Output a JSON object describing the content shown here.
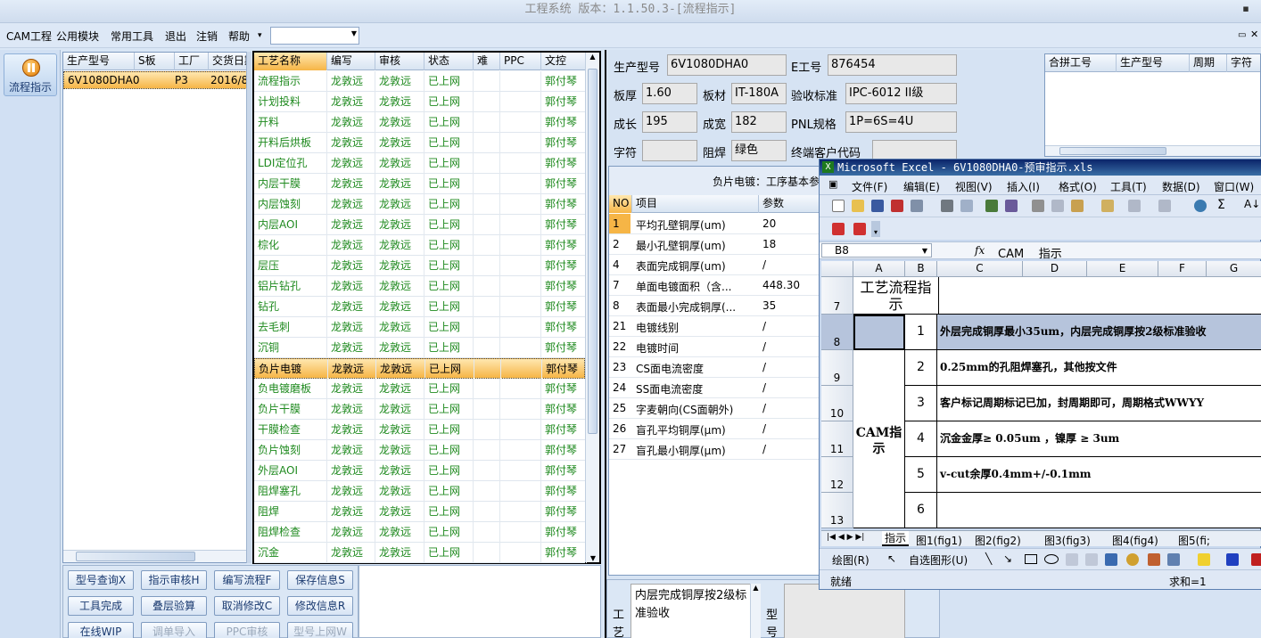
{
  "window": {
    "title": "工程系统 版本：1.1.50.3-[流程指示]"
  },
  "menu": {
    "items": [
      "CAM工程",
      "公用模块",
      "常用工具",
      "退出",
      "注销",
      "帮助"
    ],
    "combo_value": ""
  },
  "sidebar": {
    "flow_label": "流程指示"
  },
  "order_table": {
    "headers": [
      "生产型号",
      "S板",
      "工厂",
      "交货日期"
    ],
    "rows": [
      {
        "model": "6V1080DHA0",
        "s": "",
        "factory": "P3",
        "date": "2016/8"
      }
    ]
  },
  "process_table": {
    "headers": [
      "工艺名称",
      "编写",
      "审核",
      "状态",
      "难",
      "PPC",
      "文控"
    ],
    "rows": [
      {
        "name": "流程指示",
        "writer": "龙敦远",
        "reviewer": "龙敦远",
        "status": "已上网",
        "ctrl": "郭付琴"
      },
      {
        "name": "计划投料",
        "writer": "龙敦远",
        "reviewer": "龙敦远",
        "status": "已上网",
        "ctrl": "郭付琴"
      },
      {
        "name": "开料",
        "writer": "龙敦远",
        "reviewer": "龙敦远",
        "status": "已上网",
        "ctrl": "郭付琴"
      },
      {
        "name": "开料后烘板",
        "writer": "龙敦远",
        "reviewer": "龙敦远",
        "status": "已上网",
        "ctrl": "郭付琴"
      },
      {
        "name": "LDI定位孔",
        "writer": "龙敦远",
        "reviewer": "龙敦远",
        "status": "已上网",
        "ctrl": "郭付琴"
      },
      {
        "name": "内层干膜",
        "writer": "龙敦远",
        "reviewer": "龙敦远",
        "status": "已上网",
        "ctrl": "郭付琴"
      },
      {
        "name": "内层蚀刻",
        "writer": "龙敦远",
        "reviewer": "龙敦远",
        "status": "已上网",
        "ctrl": "郭付琴"
      },
      {
        "name": "内层AOI",
        "writer": "龙敦远",
        "reviewer": "龙敦远",
        "status": "已上网",
        "ctrl": "郭付琴"
      },
      {
        "name": "棕化",
        "writer": "龙敦远",
        "reviewer": "龙敦远",
        "status": "已上网",
        "ctrl": "郭付琴"
      },
      {
        "name": "层压",
        "writer": "龙敦远",
        "reviewer": "龙敦远",
        "status": "已上网",
        "ctrl": "郭付琴"
      },
      {
        "name": "铝片钻孔",
        "writer": "龙敦远",
        "reviewer": "龙敦远",
        "status": "已上网",
        "ctrl": "郭付琴"
      },
      {
        "name": "钻孔",
        "writer": "龙敦远",
        "reviewer": "龙敦远",
        "status": "已上网",
        "ctrl": "郭付琴"
      },
      {
        "name": "去毛刺",
        "writer": "龙敦远",
        "reviewer": "龙敦远",
        "status": "已上网",
        "ctrl": "郭付琴"
      },
      {
        "name": "沉铜",
        "writer": "龙敦远",
        "reviewer": "龙敦远",
        "status": "已上网",
        "ctrl": "郭付琴"
      },
      {
        "name": "负片电镀",
        "writer": "龙敦远",
        "reviewer": "龙敦远",
        "status": "已上网",
        "ctrl": "郭付琴"
      },
      {
        "name": "负电镀磨板",
        "writer": "龙敦远",
        "reviewer": "龙敦远",
        "status": "已上网",
        "ctrl": "郭付琴"
      },
      {
        "name": "负片干膜",
        "writer": "龙敦远",
        "reviewer": "龙敦远",
        "status": "已上网",
        "ctrl": "郭付琴"
      },
      {
        "name": "干膜检查",
        "writer": "龙敦远",
        "reviewer": "龙敦远",
        "status": "已上网",
        "ctrl": "郭付琴"
      },
      {
        "name": "负片蚀刻",
        "writer": "龙敦远",
        "reviewer": "龙敦远",
        "status": "已上网",
        "ctrl": "郭付琴"
      },
      {
        "name": "外层AOI",
        "writer": "龙敦远",
        "reviewer": "龙敦远",
        "status": "已上网",
        "ctrl": "郭付琴"
      },
      {
        "name": "阻焊塞孔",
        "writer": "龙敦远",
        "reviewer": "龙敦远",
        "status": "已上网",
        "ctrl": "郭付琴"
      },
      {
        "name": "阻焊",
        "writer": "龙敦远",
        "reviewer": "龙敦远",
        "status": "已上网",
        "ctrl": "郭付琴"
      },
      {
        "name": "阻焊检查",
        "writer": "龙敦远",
        "reviewer": "龙敦远",
        "status": "已上网",
        "ctrl": "郭付琴"
      },
      {
        "name": "沉金",
        "writer": "龙敦远",
        "reviewer": "龙敦远",
        "status": "已上网",
        "ctrl": "郭付琴"
      }
    ]
  },
  "buttons": [
    "型号查询X",
    "指示审核H",
    "编写流程F",
    "保存信息S",
    "工具完成",
    "叠层验算",
    "取消修改C",
    "修改信息R",
    "在线WIP",
    "调单导入",
    "PPC审核",
    "型号上网W"
  ],
  "info": {
    "model_label": "生产型号",
    "model": "6V1080DHA0",
    "eno_label": "E工号",
    "eno": "876454",
    "thick_label": "板厚",
    "thick": "1.60",
    "mat_label": "板材",
    "mat": "IT-180A",
    "std_label": "验收标准",
    "std": "IPC-6012 II级",
    "len_label": "成长",
    "len": "195",
    "wid_label": "成宽",
    "wid": "182",
    "pnl_label": "PNL规格",
    "pnl": "1P=6S=4U",
    "char_label": "字符",
    "char": "",
    "mask_label": "阻焊",
    "mask": "绿色",
    "cust_label": "终端客户代码",
    "cust": ""
  },
  "merge_table": {
    "headers": [
      "合拼工号",
      "生产型号",
      "周期",
      "字符"
    ]
  },
  "param_panel": {
    "title": "负片电镀：工序基本参",
    "headers": [
      "NO",
      "项目",
      "参数"
    ],
    "rows": [
      {
        "no": "1",
        "item": "平均孔壁铜厚(um)",
        "val": "20"
      },
      {
        "no": "2",
        "item": "最小孔壁铜厚(um)",
        "val": "18"
      },
      {
        "no": "4",
        "item": "表面完成铜厚(um)",
        "val": "/"
      },
      {
        "no": "7",
        "item": "单面电镀面积（含...",
        "val": "448.30"
      },
      {
        "no": "8",
        "item": "表面最小完成铜厚(...",
        "val": "35"
      },
      {
        "no": "21",
        "item": "电镀线别",
        "val": "/"
      },
      {
        "no": "22",
        "item": "电镀时间",
        "val": "/"
      },
      {
        "no": "23",
        "item": "CS面电流密度",
        "val": "/"
      },
      {
        "no": "24",
        "item": "SS面电流密度",
        "val": "/"
      },
      {
        "no": "25",
        "item": "字麦朝向(CS面朝外)",
        "val": "/"
      },
      {
        "no": "26",
        "item": "盲孔平均铜厚(μm)",
        "val": "/"
      },
      {
        "no": "27",
        "item": "盲孔最小铜厚(μm)",
        "val": "/"
      }
    ]
  },
  "bottom": {
    "note": "内层完成铜厚按2级标准验收",
    "gong": "工",
    "yi": "艺",
    "xing": "型",
    "hao": "号"
  },
  "excel": {
    "title": "Microsoft Excel - 6V1080DHA0-预审指示.xls",
    "menu": [
      "文件(F)",
      "编辑(E)",
      "视图(V)",
      "插入(I)",
      "格式(O)",
      "工具(T)",
      "数据(D)",
      "窗口(W)"
    ],
    "namebox": "B8",
    "fx": "fx",
    "formula": "CAM    指示",
    "cols": [
      "A",
      "B",
      "C",
      "D",
      "E",
      "F",
      "G"
    ],
    "rows": [
      "7",
      "8",
      "9",
      "10",
      "11",
      "12",
      "13"
    ],
    "header_cell": "工艺流程指示",
    "cam_cell": "CAM指示",
    "items": [
      {
        "n": "1",
        "text": "外层完成铜厚最小35um，内层完成铜厚按2级标准验收"
      },
      {
        "n": "2",
        "text": "0.25mm的孔阻焊塞孔，其他按文件"
      },
      {
        "n": "3",
        "text": "客户标记周期标记已加，封周期即可，周期格式WWYY"
      },
      {
        "n": "4",
        "text": "沉金金厚≥ 0.05um ，镍厚 ≥ 3um"
      },
      {
        "n": "5",
        "text": "v-cut余厚0.4mm+/-0.1mm"
      },
      {
        "n": "6",
        "text": ""
      }
    ],
    "tabs": [
      "指示",
      "图1(fig1)",
      "图2(fig2)",
      "图3(fig3)",
      "图4(fig4)",
      "图5(fi;"
    ],
    "draw_label": "绘图(R)",
    "autoshape_label": "自选图形(U)",
    "status": "就绪",
    "sum": "求和=1"
  },
  "colors": {
    "green_text": "#1f8a1f",
    "selected_row": "#f6b546",
    "excel_title": "#0a246a"
  }
}
